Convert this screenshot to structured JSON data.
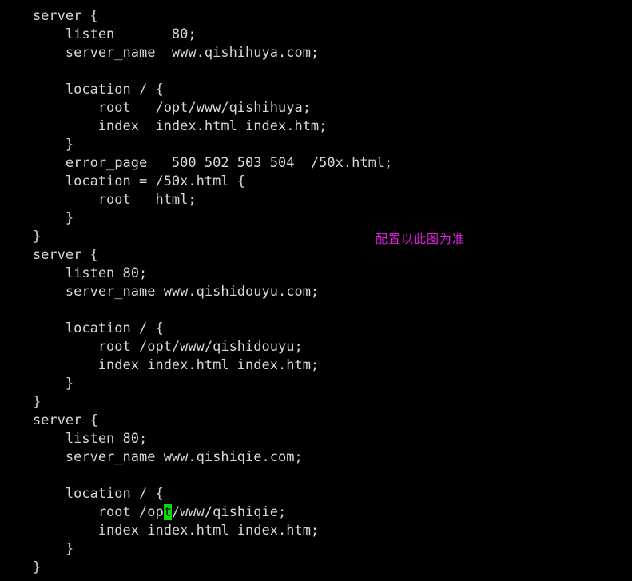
{
  "editor": {
    "background_color": "#000000",
    "text_color": "#d8d8d8",
    "cursor_color": "#00e000",
    "annotation_color": "#e020e0"
  },
  "annotation": {
    "text": "配置以此图为准"
  },
  "cursor": {
    "char": "/",
    "line_index": 26,
    "column": 20
  },
  "code": {
    "lines": [
      {
        "id": "line-01",
        "text": "    server {"
      },
      {
        "id": "line-02",
        "text": "        listen       80;"
      },
      {
        "id": "line-03",
        "text": "        server_name  www.qishihuya.com;"
      },
      {
        "id": "line-04",
        "text": ""
      },
      {
        "id": "line-05",
        "text": "        location / {"
      },
      {
        "id": "line-06",
        "text": "            root   /opt/www/qishihuya;"
      },
      {
        "id": "line-07",
        "text": "            index  index.html index.htm;"
      },
      {
        "id": "line-08",
        "text": "        }"
      },
      {
        "id": "line-09",
        "text": "        error_page   500 502 503 504  /50x.html;"
      },
      {
        "id": "line-10",
        "text": "        location = /50x.html {"
      },
      {
        "id": "line-11",
        "text": "            root   html;"
      },
      {
        "id": "line-12",
        "text": "        }"
      },
      {
        "id": "line-13",
        "text": "    }"
      },
      {
        "id": "line-14",
        "text": "    server {"
      },
      {
        "id": "line-15",
        "text": "        listen 80;"
      },
      {
        "id": "line-16",
        "text": "        server_name www.qishidouyu.com;"
      },
      {
        "id": "line-17",
        "text": ""
      },
      {
        "id": "line-18",
        "text": "        location / {"
      },
      {
        "id": "line-19",
        "text": "            root /opt/www/qishidouyu;"
      },
      {
        "id": "line-20",
        "text": "            index index.html index.htm;"
      },
      {
        "id": "line-21",
        "text": "        }"
      },
      {
        "id": "line-22",
        "text": "    }"
      },
      {
        "id": "line-23",
        "text": "    server {"
      },
      {
        "id": "line-24",
        "text": "        listen 80;"
      },
      {
        "id": "line-25",
        "text": "        server_name www.qishiqie.com;"
      },
      {
        "id": "line-26",
        "text": ""
      },
      {
        "id": "line-27",
        "text": "        location / {"
      },
      {
        "id": "line-28",
        "text": "            root /opt/www/qishiqie;",
        "cursor_col": 20
      },
      {
        "id": "line-29",
        "text": "            index index.html index.htm;"
      },
      {
        "id": "line-30",
        "text": "        }"
      },
      {
        "id": "line-31",
        "text": "    }"
      }
    ]
  }
}
